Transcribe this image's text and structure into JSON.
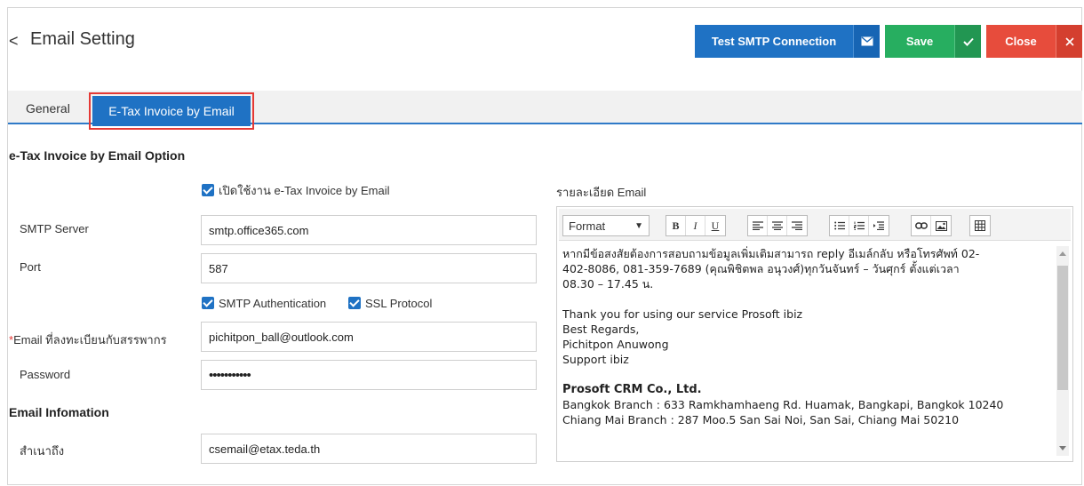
{
  "header": {
    "back_glyph": "<",
    "title": "Email Setting",
    "test_label": "Test SMTP Connection",
    "save_label": "Save",
    "close_label": "Close"
  },
  "tabs": {
    "general": "General",
    "etax": "E-Tax Invoice by Email",
    "active": "E-Tax Invoice by Email"
  },
  "section1": {
    "title": "e-Tax Invoice by Email Option",
    "enable_label": "เปิดใช้งาน e-Tax Invoice by Email",
    "enable_checked": true
  },
  "form": {
    "smtp_server_label": "SMTP Server",
    "smtp_server_value": "smtp.office365.com",
    "port_label": "Port",
    "port_value": "587",
    "smtp_auth_label": "SMTP Authentication",
    "smtp_auth_checked": true,
    "ssl_label": "SSL Protocol",
    "ssl_checked": true,
    "email_required": "*",
    "email_label": "Email ที่ลงทะเบียนกับสรรพากร",
    "email_value": "pichitpon_ball@outlook.com",
    "password_label": "Password",
    "password_value": "•••••••••••"
  },
  "section2": {
    "title": "Email Infomation",
    "cc_label": "สำเนาถึง",
    "cc_value": "csemail@etax.teda.th"
  },
  "editor": {
    "label": "รายละเอียด Email",
    "format_label": "Format",
    "content": {
      "line1": "หากมีข้อสงสัยต้องการสอบถามข้อมูลเพิ่มเติมสามารถ reply อีเมล์กลับ หรือโทรศัพท์ 02-",
      "line2": "402-8086, 081-359-7689 (คุณพิชิตพล อนุวงศ์)ทุกวันจันทร์ – วันศุกร์ ตั้งแต่เวลา",
      "line3": "08.30 – 17.45 น.",
      "line4": "Thank you for using our service Prosoft ibiz",
      "line5": "Best Regards,",
      "line6": "Pichitpon Anuwong",
      "line7": "Support ibiz",
      "line8": "Prosoft CRM Co., Ltd.",
      "line9": "Bangkok Branch : 633 Ramkhamhaeng Rd. Huamak, Bangkapi, Bangkok 10240",
      "line10": "Chiang Mai Branch : 287 Moo.5 San Sai Noi, San Sai, Chiang Mai 50210"
    }
  },
  "colors": {
    "primary": "#1f72c4",
    "save": "#27ae60",
    "close": "#e74c3c",
    "highlight": "#e53935"
  }
}
